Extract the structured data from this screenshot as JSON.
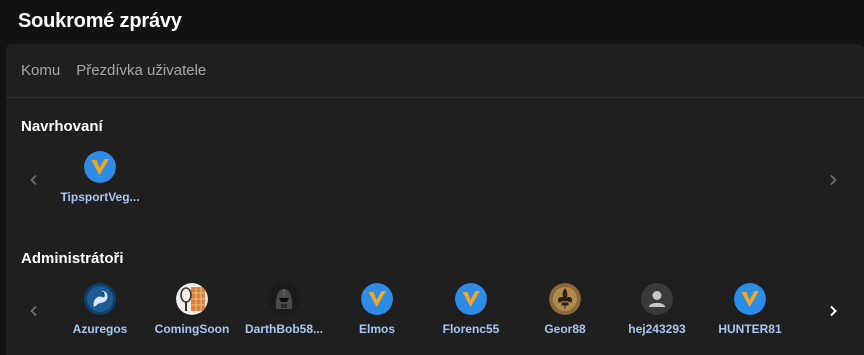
{
  "header": {
    "title": "Soukromé zprávy"
  },
  "compose": {
    "to_label": "Komu",
    "placeholder": "Přezdívka uživatele"
  },
  "suggested": {
    "title": "Navrhovaní",
    "users": [
      {
        "name": "TipsportVeg...",
        "avatar": "tipsport-logo"
      }
    ]
  },
  "admins": {
    "title": "Administrátoři",
    "users": [
      {
        "name": "Azuregos",
        "avatar": "dragon-avatar"
      },
      {
        "name": "ComingSoon",
        "avatar": "tennis-racket-avatar"
      },
      {
        "name": "DarthBob58...",
        "avatar": "dark-helmet-avatar"
      },
      {
        "name": "Elmos",
        "avatar": "tipsport-logo"
      },
      {
        "name": "Florenc55",
        "avatar": "tipsport-logo"
      },
      {
        "name": "Geor88",
        "avatar": "fleur-de-lis-avatar"
      },
      {
        "name": "hej243293",
        "avatar": "default-user-avatar"
      },
      {
        "name": "HUNTER81",
        "avatar": "tipsport-logo"
      }
    ]
  },
  "colors": {
    "accent": "#2d8ce6",
    "logo_orange": "#f5a623",
    "username": "#a8c8f4"
  }
}
